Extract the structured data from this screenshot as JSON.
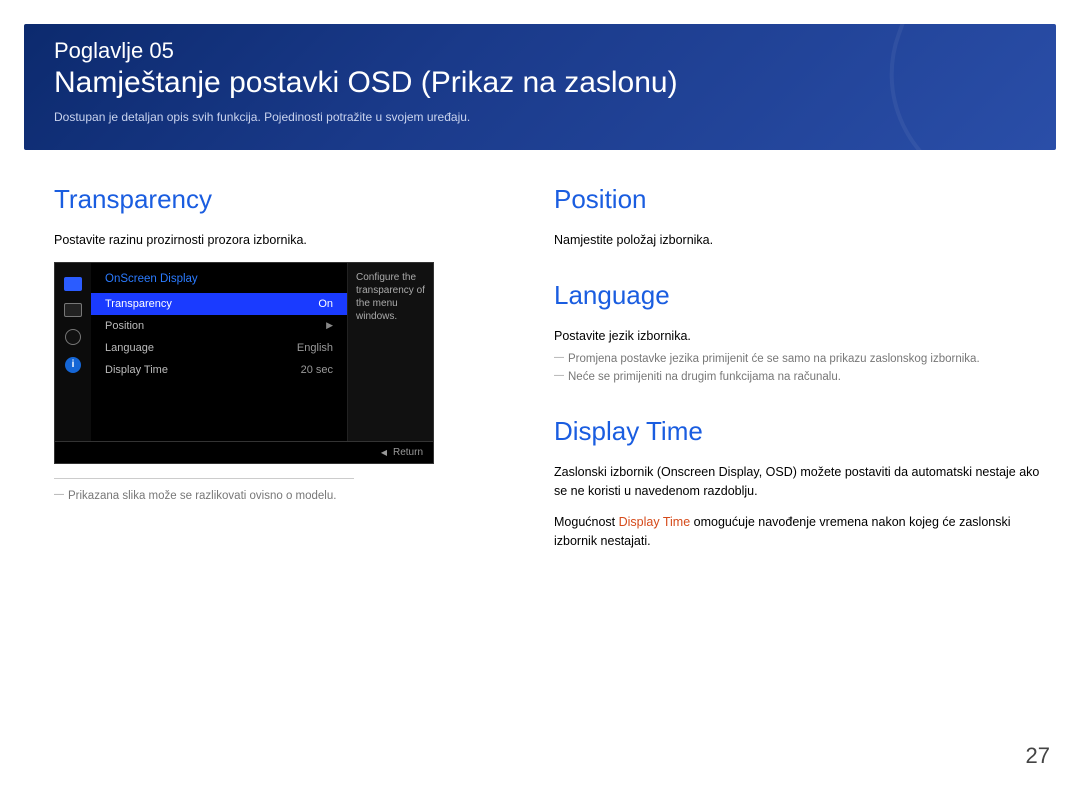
{
  "banner": {
    "chapter_label": "Poglavlje 05",
    "title": "Namještanje postavki OSD (Prikaz na zaslonu)",
    "subtitle": "Dostupan je detaljan opis svih funkcija. Pojedinosti potražite u svojem uređaju."
  },
  "left": {
    "section_title": "Transparency",
    "intro": "Postavite razinu prozirnosti prozora izbornika.",
    "osd": {
      "header": "OnScreen Display",
      "rows": [
        {
          "label": "Transparency",
          "value": "On",
          "selected": true
        },
        {
          "label": "Position",
          "value": "",
          "arrow": true
        },
        {
          "label": "Language",
          "value": "English"
        },
        {
          "label": "Display Time",
          "value": "20 sec"
        }
      ],
      "help": "Configure the transparency of the menu windows.",
      "footer_return": "Return"
    },
    "footnote": "Prikazana slika može se razlikovati ovisno o modelu."
  },
  "right": {
    "position": {
      "title": "Position",
      "body": "Namjestite položaj izbornika."
    },
    "language": {
      "title": "Language",
      "body": "Postavite jezik izbornika.",
      "note1": "Promjena postavke jezika primijenit će se samo na prikazu zaslonskog izbornika.",
      "note2": "Neće se primijeniti na drugim funkcijama na računalu."
    },
    "display_time": {
      "title": "Display Time",
      "body1": "Zaslonski izbornik (Onscreen Display, OSD) možete postaviti da automatski nestaje ako se ne koristi u navedenom razdoblju.",
      "body2_prefix": "Mogućnost ",
      "body2_highlight": "Display Time",
      "body2_suffix": " omogućuje navođenje vremena nakon kojeg će zaslonski izbornik nestajati."
    }
  },
  "page_number": "27"
}
